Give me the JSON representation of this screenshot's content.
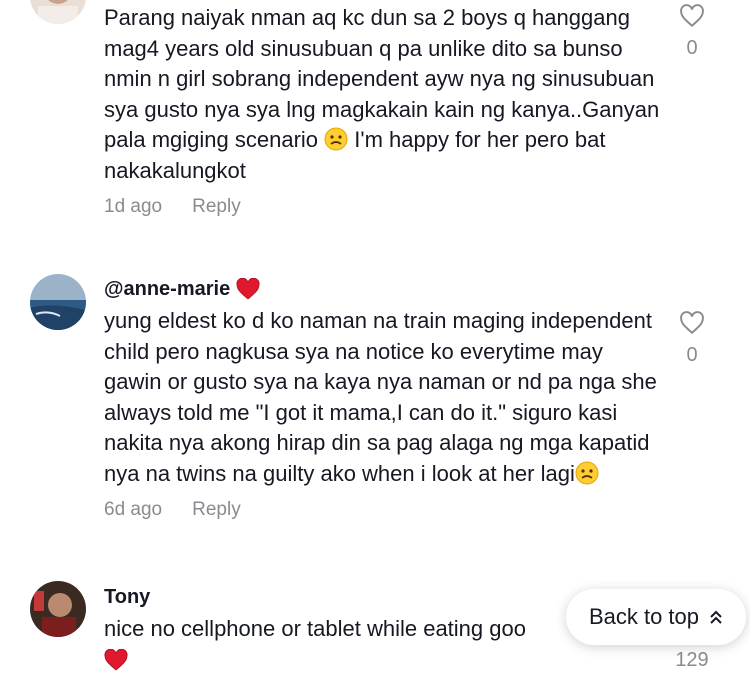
{
  "comments": [
    {
      "text_prefix": "Parang naiyak nman aq kc dun sa 2 boys q hanggang mag4 years old sinusubuan q pa unlike dito sa bunso nmin n girl sobrang independent ayw nya ng sinusubuan sya gusto nya sya lng magkakain kain ng kanya..Ganyan pala mgiging scenario",
      "text_suffix": "I'm happy for her pero bat nakakalungkot",
      "time": "1d ago",
      "reply": "Reply",
      "likes": "0",
      "emoji_icon": "worried-face-icon"
    },
    {
      "username": "@anne-marie",
      "username_badge_icon": "red-heart-icon",
      "text": "yung eldest ko d ko naman na train maging independent child pero nagkusa sya na notice ko everytime may gawin or gusto sya na kaya nya naman or nd pa nga she always told me \"I got it mama,I can do it.\" siguro kasi nakita nya akong hirap din sa pag alaga ng mga kapatid nya na twins na guilty ako when i look at her lagi",
      "emoji_icon": "worried-face-icon",
      "time": "6d ago",
      "reply": "Reply",
      "likes": "0"
    },
    {
      "username": "Tony",
      "text": "nice no cellphone or tablet while eating goo",
      "trailing_icon": "red-heart-icon",
      "likes": "129"
    }
  ],
  "back_to_top": {
    "label": "Back to top",
    "icon": "double-chevron-up-icon"
  },
  "colors": {
    "text": "#161823",
    "muted": "#8a8b91",
    "heart": "#fe2c55"
  }
}
